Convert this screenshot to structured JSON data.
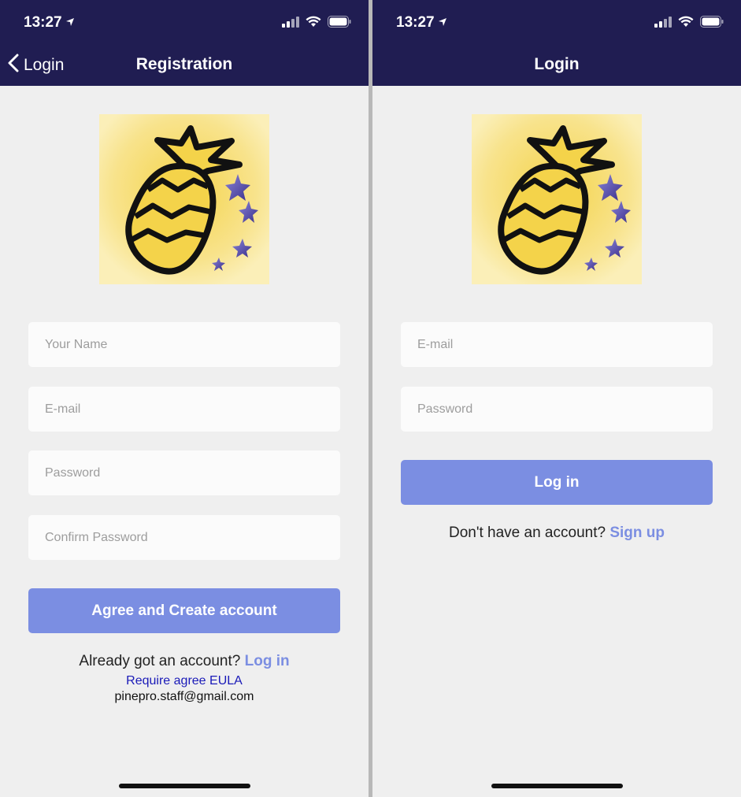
{
  "colors": {
    "navbar": "#201d52",
    "background": "#efefef",
    "primary_button": "#7b8ee2",
    "link": "#7b8ee2",
    "eula_link": "#1a1ab8"
  },
  "registration": {
    "status_time": "13:27",
    "back_label": "Login",
    "title": "Registration",
    "name_placeholder": "Your Name",
    "email_placeholder": "E-mail",
    "password_placeholder": "Password",
    "confirm_placeholder": "Confirm Password",
    "create_button": "Agree and Create account",
    "already_text": "Already got an account?",
    "login_link": "Log in",
    "eula_link": "Require agree EULA",
    "contact_email": "pinepro.staff@gmail.com"
  },
  "login": {
    "status_time": "13:27",
    "title": "Login",
    "email_placeholder": "E-mail",
    "password_placeholder": "Password",
    "login_button": "Log in",
    "no_account_text": "Don't have an account?",
    "signup_link": "Sign up"
  }
}
